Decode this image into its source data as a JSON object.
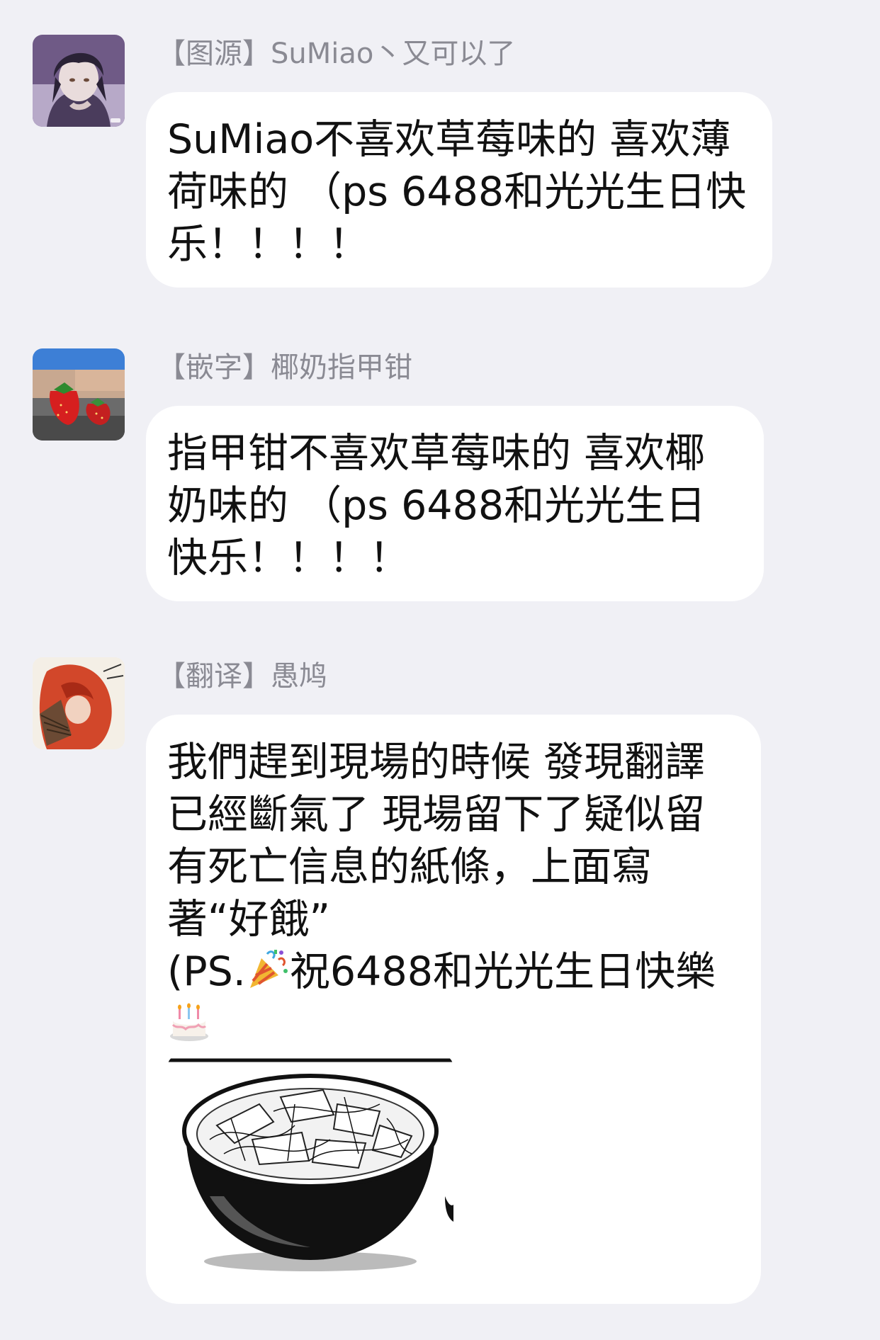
{
  "chat": {
    "messages": [
      {
        "sender": "【图源】SuMiao丶又可以了",
        "avatar_icon": "avatar-dark-haired-character-icon",
        "text": "SuMiao不喜欢草莓味的 喜欢薄荷味的 （ps 6488和光光生日快乐！！！！"
      },
      {
        "sender": "【嵌字】椰奶指甲钳",
        "avatar_icon": "avatar-strawberry-photo-icon",
        "text": "指甲钳不喜欢草莓味的 喜欢椰奶味的 （ps 6488和光光生日快乐！！！！"
      },
      {
        "sender": "【翻译】愚鸠",
        "avatar_icon": "avatar-red-haired-character-icon",
        "text_line1": "我們趕到現場的時候 發現翻譯已經斷氣了 現場留下了疑似留有死亡信息的紙條，上面寫著“好餓”",
        "text_line2_prefix": "(PS.",
        "text_line2_suffix": "祝6488和光光生日快樂",
        "emoji_party": "party-popper-emoji",
        "emoji_cake": "birthday-cake-emoji",
        "image": "manga-ramen-bowl-image"
      }
    ]
  },
  "colors": {
    "background": "#f0f0f5",
    "bubble": "#ffffff",
    "sender_text": "#8a8a93",
    "message_text": "#111111"
  }
}
